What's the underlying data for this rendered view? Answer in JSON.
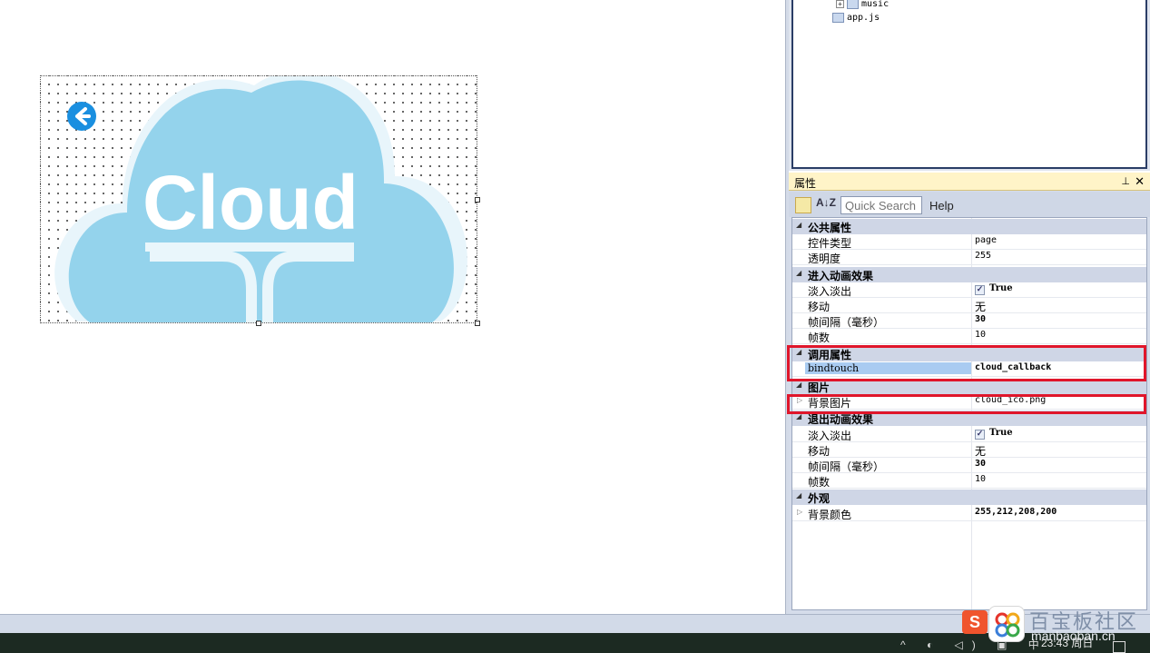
{
  "canvas": {
    "cloud_text": "Cloud"
  },
  "tree": {
    "items": [
      {
        "label": "music"
      },
      {
        "label": "app.js"
      }
    ]
  },
  "props": {
    "title": "属性",
    "pin_icon": "pin-icon",
    "close_icon": "close-icon",
    "toolbar": {
      "quick_search_placeholder": "Quick Search",
      "help_label": "Help"
    },
    "categories": {
      "common": "公共属性",
      "enter_anim": "进入动画效果",
      "call": "调用属性",
      "image": "图片",
      "exit_anim": "退出动画效果",
      "appearance": "外观"
    },
    "rows": {
      "control_type": {
        "name": "控件类型",
        "value": "page"
      },
      "opacity": {
        "name": "透明度",
        "value": "255"
      },
      "enter_fade": {
        "name": "淡入淡出",
        "value": "True"
      },
      "enter_move": {
        "name": "移动",
        "value": "无"
      },
      "enter_interval": {
        "name": "帧间隔（毫秒）",
        "value": "30"
      },
      "enter_frames": {
        "name": "帧数",
        "value": "10"
      },
      "bindtouch": {
        "name": "bindtouch",
        "value": "cloud_callback"
      },
      "bg_image": {
        "name": "背景图片",
        "value": "cloud_ico.png"
      },
      "exit_fade": {
        "name": "淡入淡出",
        "value": "True"
      },
      "exit_move": {
        "name": "移动",
        "value": "无"
      },
      "exit_interval": {
        "name": "帧间隔（毫秒）",
        "value": "30"
      },
      "exit_frames": {
        "name": "帧数",
        "value": "10"
      },
      "bg_color": {
        "name": "背景颜色",
        "value": "255,212,208,200"
      }
    }
  },
  "taskbar": {
    "clock": "23:43 周日",
    "tray_glyphs": "^ ◐ ◁) ▣ 中"
  },
  "watermark": {
    "text": "百宝板社区",
    "url": "manbaoban.cn"
  },
  "colors": {
    "cloud": "#94d3ec",
    "back_button": "#1a8fe0",
    "highlight": "#e0162b",
    "selection": "#a9cbf1"
  }
}
